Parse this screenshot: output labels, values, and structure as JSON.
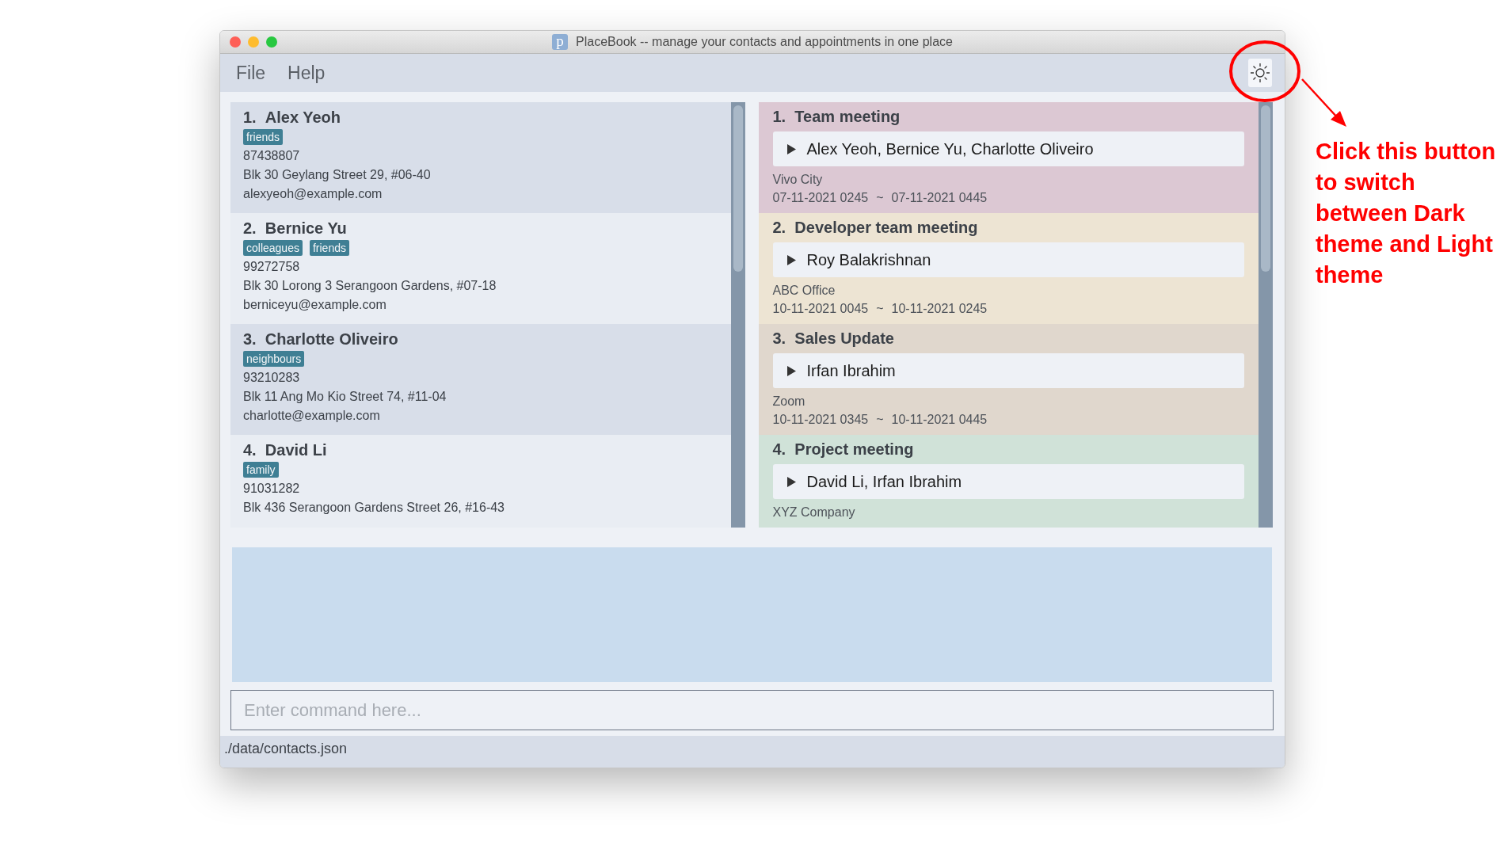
{
  "window": {
    "title": "PlaceBook -- manage your contacts and appointments in one place",
    "icon_letter": "p"
  },
  "menu": [
    "File",
    "Help"
  ],
  "contacts": [
    {
      "index": "1.",
      "name": "Alex Yeoh",
      "tags": [
        "friends"
      ],
      "phone": "87438807",
      "address": "Blk 30 Geylang Street 29, #06-40",
      "email": "alexyeoh@example.com"
    },
    {
      "index": "2.",
      "name": "Bernice Yu",
      "tags": [
        "colleagues",
        "friends"
      ],
      "phone": "99272758",
      "address": "Blk 30 Lorong 3 Serangoon Gardens, #07-18",
      "email": "berniceyu@example.com"
    },
    {
      "index": "3.",
      "name": "Charlotte Oliveiro",
      "tags": [
        "neighbours"
      ],
      "phone": "93210283",
      "address": "Blk 11 Ang Mo Kio Street 74, #11-04",
      "email": "charlotte@example.com"
    },
    {
      "index": "4.",
      "name": "David Li",
      "tags": [
        "family"
      ],
      "phone": "91031282",
      "address": "Blk 436 Serangoon Gardens Street 26, #16-43"
    }
  ],
  "appointments": [
    {
      "index": "1.",
      "title": "Team meeting",
      "color": "#dcc8d3",
      "participants": "Alex Yeoh, Bernice Yu, Charlotte Oliveiro",
      "expanded": false,
      "location": "Vivo City",
      "start": "07-11-2021 0245",
      "separator": "~",
      "end": "07-11-2021 0445"
    },
    {
      "index": "2.",
      "title": "Developer team meeting",
      "color": "#ede4d3",
      "participants": "Roy Balakrishnan",
      "expanded": false,
      "location": "ABC Office",
      "start": "10-11-2021 0045",
      "separator": "~",
      "end": "10-11-2021 0245"
    },
    {
      "index": "3.",
      "title": "Sales Update",
      "color": "#e0d7cd",
      "participants": "Irfan Ibrahim",
      "expanded": false,
      "location": "Zoom",
      "start": "10-11-2021 0345",
      "separator": "~",
      "end": "10-11-2021 0445"
    },
    {
      "index": "4.",
      "title": "Project meeting",
      "color": "#d0e2d8",
      "participants": "David Li, Irfan Ibrahim",
      "expanded": false,
      "location": "XYZ Company"
    }
  ],
  "command_box": {
    "placeholder": "Enter command here..."
  },
  "status_bar": "./data/contacts.json",
  "annotation": {
    "text": "Click this button to switch between Dark theme and Light theme"
  }
}
